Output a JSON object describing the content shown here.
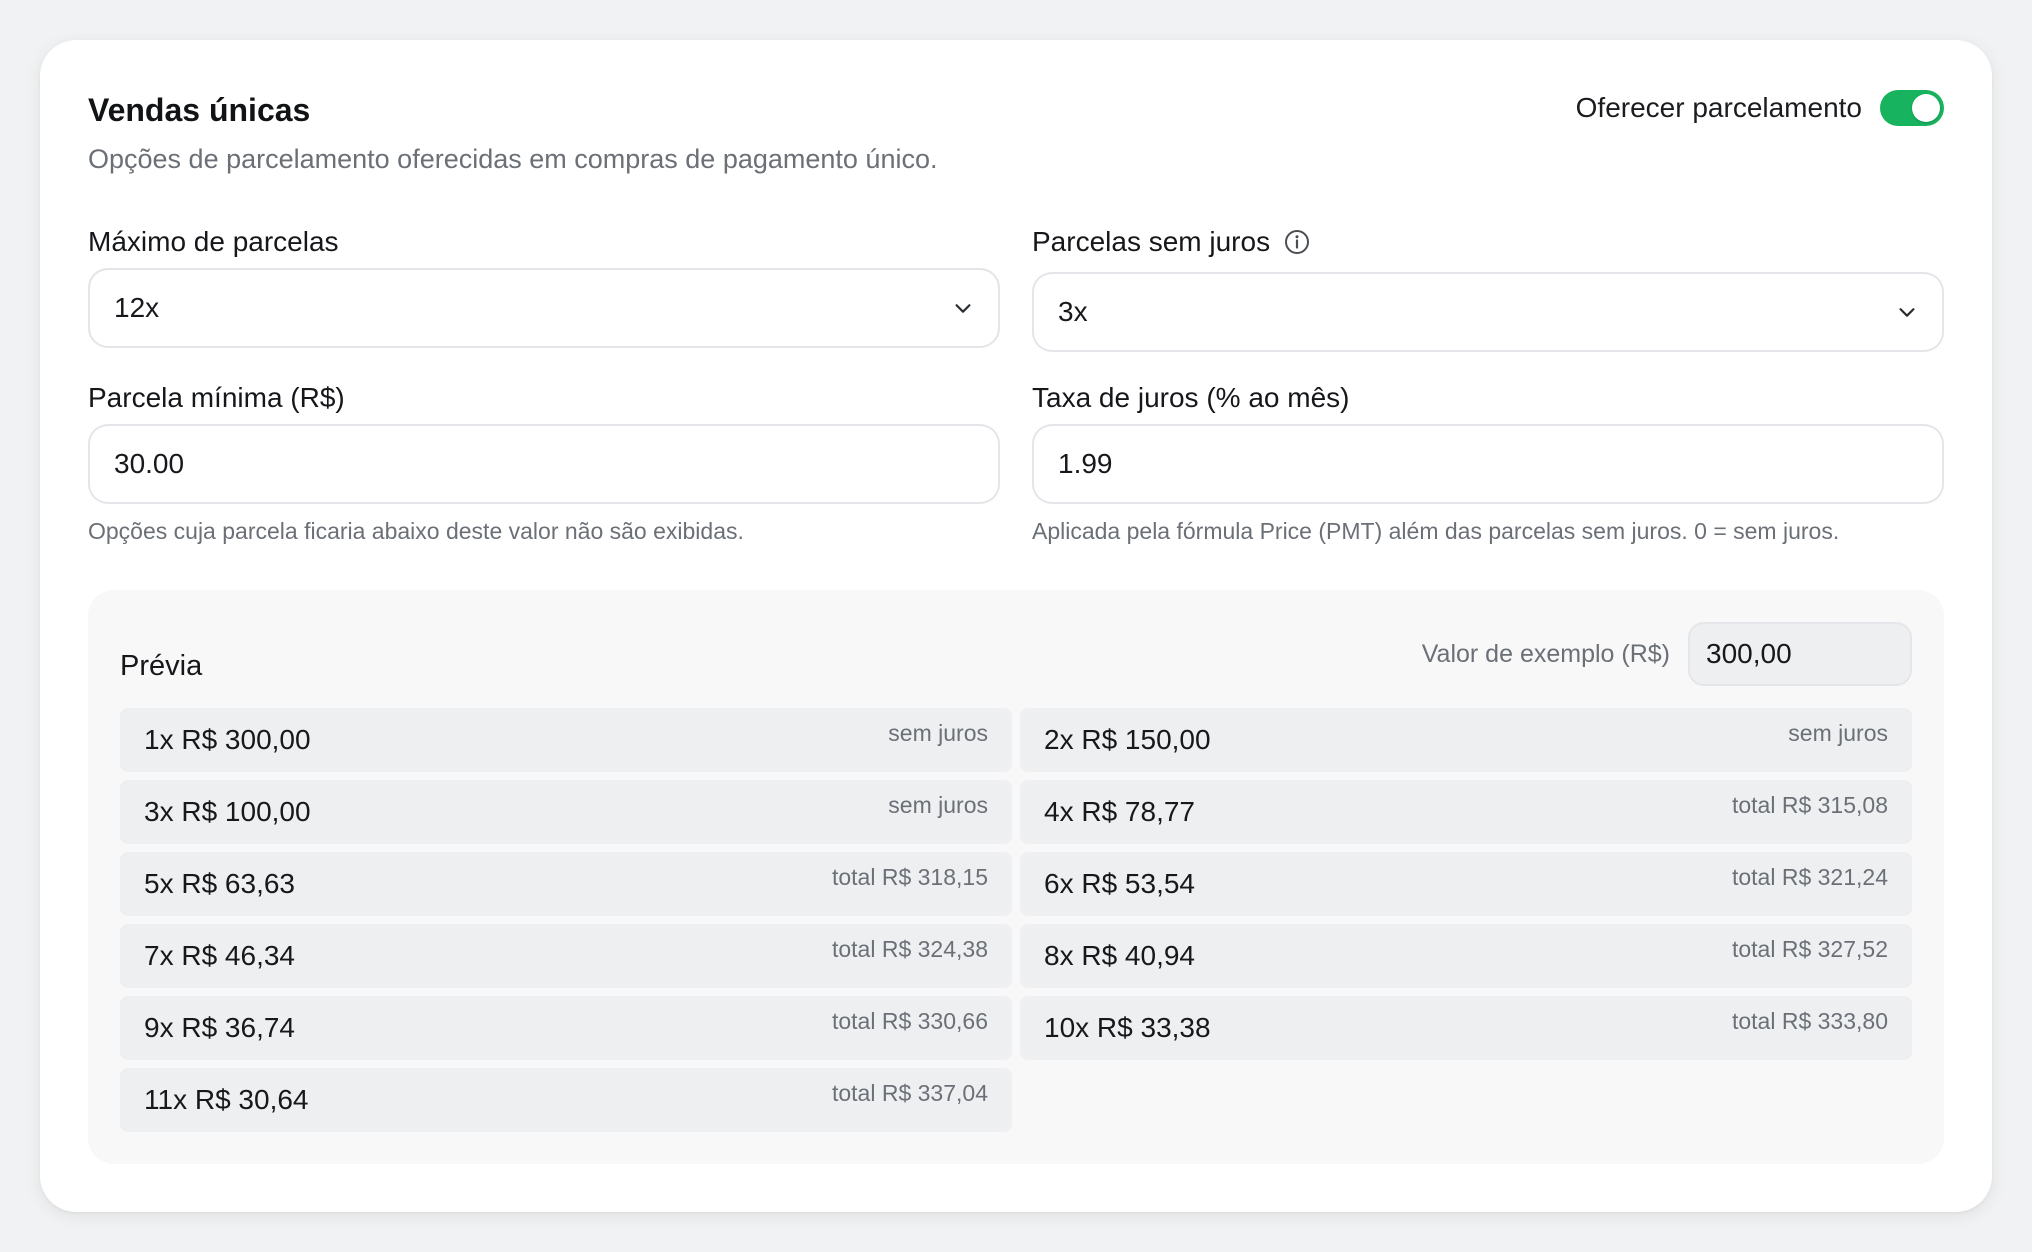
{
  "section": {
    "title": "Vendas únicas",
    "subtitle": "Opções de parcelamento oferecidas em compras de pagamento único."
  },
  "toggle": {
    "label": "Oferecer parcelamento",
    "on": true,
    "color": "#17b35e"
  },
  "fields": {
    "max_installments": {
      "label": "Máximo de parcelas",
      "value": "12x"
    },
    "interest_free": {
      "label": "Parcelas sem juros",
      "value": "3x",
      "icon": "info-icon"
    },
    "min_installment": {
      "label": "Parcela mínima (R$)",
      "value": "30.00",
      "hint": "Opções cuja parcela ficaria abaixo deste valor não são exibidas."
    },
    "interest_rate": {
      "label": "Taxa de juros (% ao mês)",
      "value": "1.99",
      "hint": "Aplicada pela fórmula Price (PMT) além das parcelas sem juros. 0 = sem juros."
    }
  },
  "preview": {
    "title": "Prévia",
    "example_label": "Valor de exemplo (R$)",
    "example_value": "300,00",
    "rows": [
      {
        "main": "1x R$ 300,00",
        "note": "sem juros"
      },
      {
        "main": "2x R$ 150,00",
        "note": "sem juros"
      },
      {
        "main": "3x R$ 100,00",
        "note": "sem juros"
      },
      {
        "main": "4x R$ 78,77",
        "note": "total R$ 315,08"
      },
      {
        "main": "5x R$ 63,63",
        "note": "total R$ 318,15"
      },
      {
        "main": "6x R$ 53,54",
        "note": "total R$ 321,24"
      },
      {
        "main": "7x R$ 46,34",
        "note": "total R$ 324,38"
      },
      {
        "main": "8x R$ 40,94",
        "note": "total R$ 327,52"
      },
      {
        "main": "9x R$ 36,74",
        "note": "total R$ 330,66"
      },
      {
        "main": "10x R$ 33,38",
        "note": "total R$ 333,80"
      },
      {
        "main": "11x R$ 30,64",
        "note": "total R$ 337,04"
      }
    ]
  }
}
